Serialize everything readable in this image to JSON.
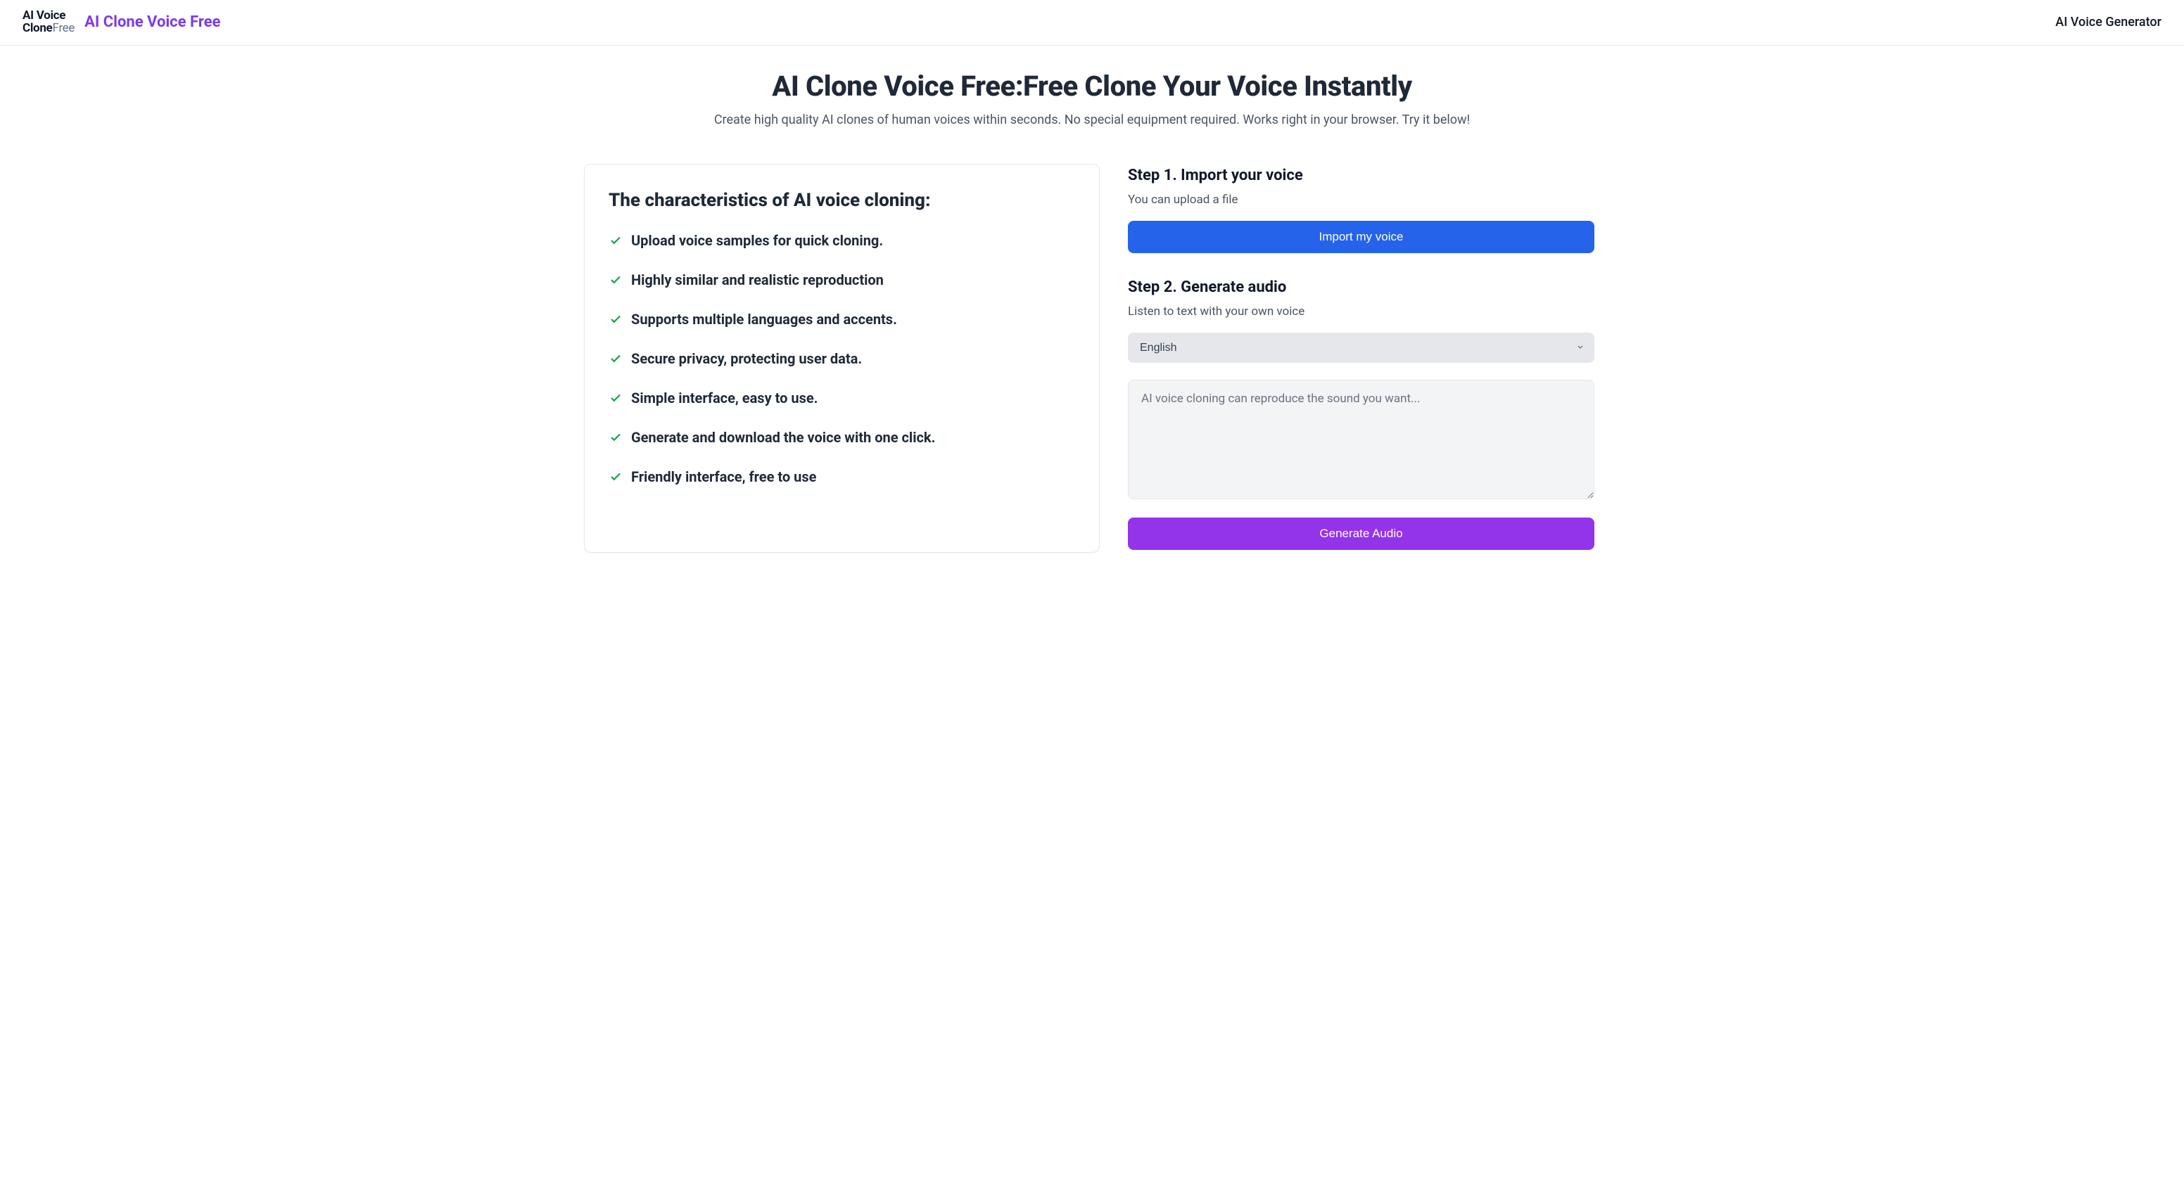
{
  "header": {
    "logo_line1": "AI Voice",
    "logo_line2_bold": "Clone",
    "logo_line2_light": "Free",
    "brand": "AI Clone Voice Free",
    "nav_link": "AI Voice Generator"
  },
  "hero": {
    "title": "AI Clone Voice Free:Free Clone Your Voice Instantly",
    "subtitle": "Create high quality AI clones of human voices within seconds. No special equipment required. Works right in your browser. Try it below!"
  },
  "features": {
    "heading": "The characteristics of AI voice cloning:",
    "items": [
      "Upload voice samples for quick cloning.",
      "Highly similar and realistic reproduction",
      "Supports multiple languages and accents.",
      "Secure privacy, protecting user data.",
      "Simple interface, easy to use.",
      "Generate and download the voice with one click.",
      "Friendly interface, free to use"
    ]
  },
  "step1": {
    "title": "Step 1. Import your voice",
    "desc": "You can upload a file",
    "button": "Import my voice"
  },
  "step2": {
    "title": "Step 2. Generate audio",
    "desc": "Listen to text with your own voice",
    "language_selected": "English",
    "textarea_placeholder": "AI voice cloning can reproduce the sound you want...",
    "textarea_value": "",
    "button": "Generate Audio"
  }
}
